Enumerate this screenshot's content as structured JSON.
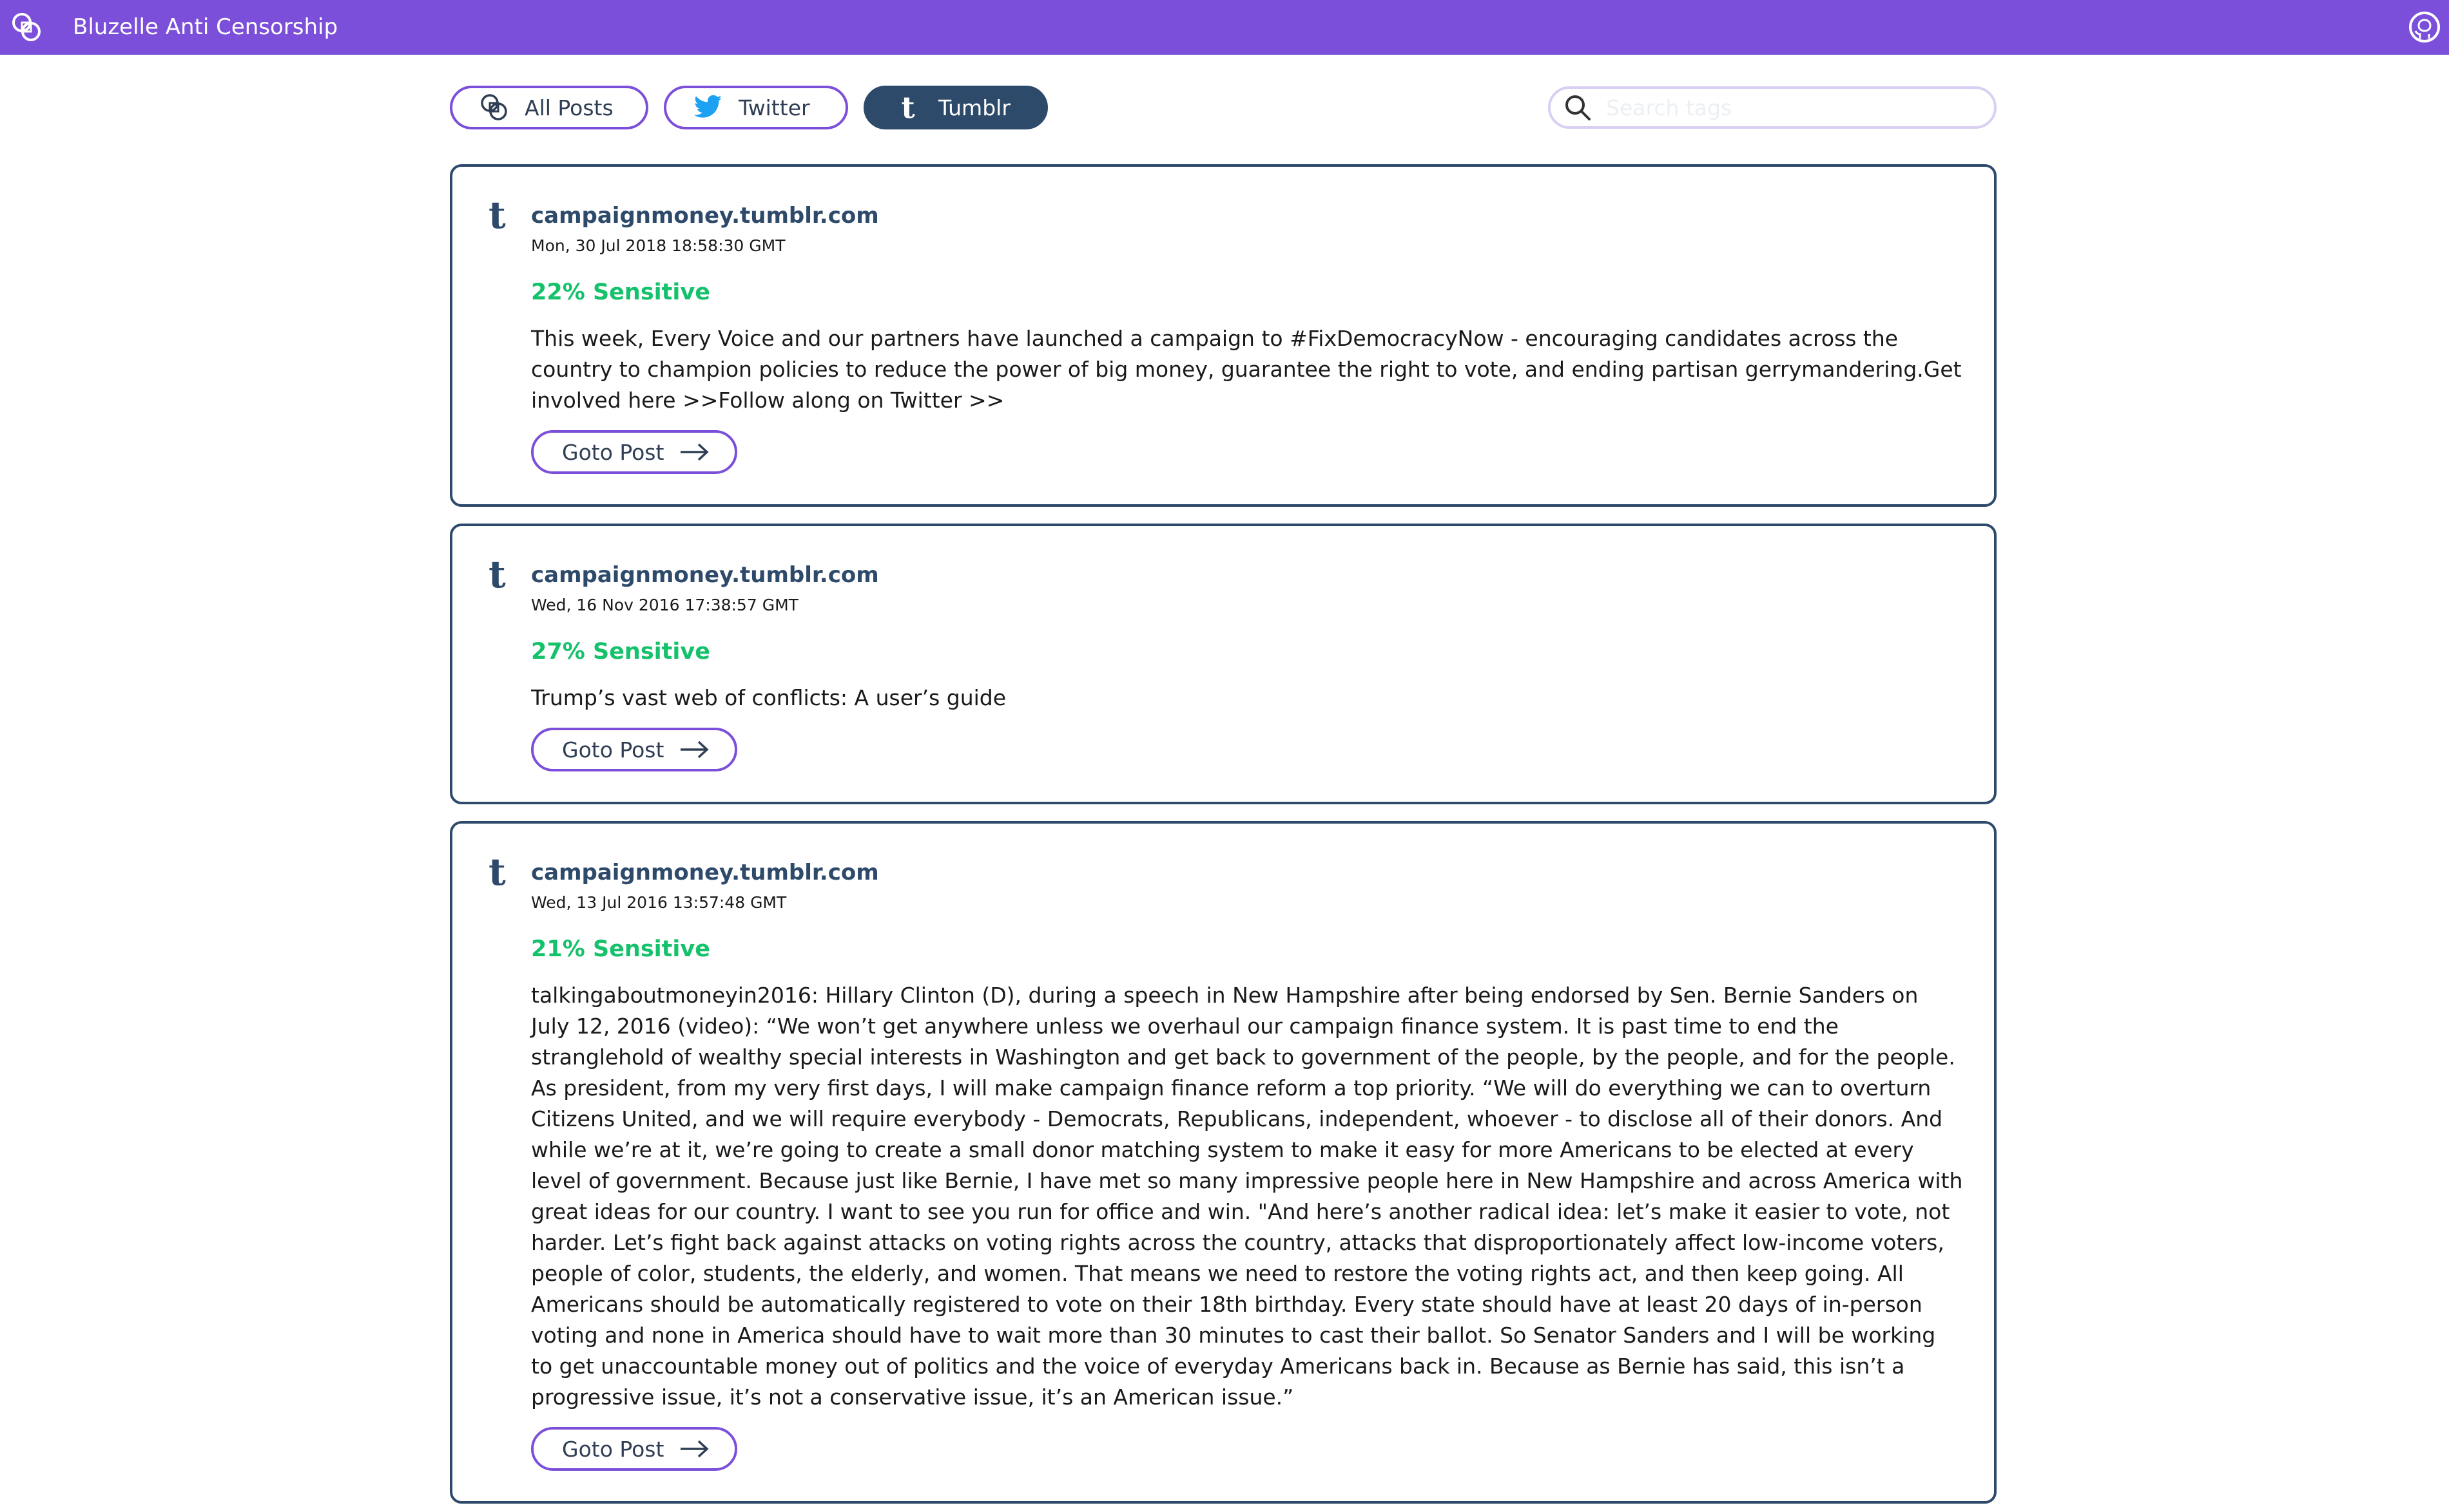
{
  "app": {
    "title": "Bluzelle Anti Censorship",
    "brand_color": "#7b4fd9"
  },
  "filters": [
    {
      "label": "All Posts",
      "icon": "bluzelle-logo-icon",
      "active": false
    },
    {
      "label": "Twitter",
      "icon": "twitter-icon",
      "active": false
    },
    {
      "label": "Tumblr",
      "icon": "tumblr-icon",
      "active": true
    }
  ],
  "search": {
    "placeholder": "Search tags",
    "value": ""
  },
  "posts": [
    {
      "author": "campaignmoney.tumblr.com",
      "date": "Mon, 30 Jul 2018 18:58:30 GMT",
      "sensitivity": "22% Sensitive",
      "body": "This week, Every Voice and our partners have launched a campaign to #FixDemocracyNow - encouraging candidates across the country to champion policies to reduce the power of big money, guarantee the right to vote, and ending partisan gerrymandering.Get involved here >>Follow along on Twitter >>",
      "button": "Goto Post"
    },
    {
      "author": "campaignmoney.tumblr.com",
      "date": "Wed, 16 Nov 2016 17:38:57 GMT",
      "sensitivity": "27% Sensitive",
      "body": "Trump’s vast web of conflicts: A user’s guide",
      "button": "Goto Post"
    },
    {
      "author": "campaignmoney.tumblr.com",
      "date": "Wed, 13 Jul 2016 13:57:48 GMT",
      "sensitivity": "21% Sensitive",
      "body": "talkingaboutmoneyin2016: Hillary Clinton (D), during a speech in New Hampshire after being endorsed by Sen. Bernie Sanders on July 12, 2016 (video): “We won’t get anywhere unless we overhaul our campaign finance system. It is past time to end the stranglehold of wealthy special interests in Washington and get back to government of the people, by the people, and for the people. As president, from my very first days, I will make campaign finance reform a top priority. “We will do everything we can to overturn Citizens United, and we will require everybody - Democrats, Republicans, independent, whoever - to disclose all of their donors. And while we’re at it, we’re going to create a small donor matching system to make it easy for more Americans to be elected at every level of government. Because just like Bernie, I have met so many impressive people here in New Hampshire and across America with great ideas for our country. I want to see you run for office and win. \"And here’s another radical idea: let’s make it easier to vote, not harder. Let’s fight back against attacks on voting rights across the country, attacks that disproportionately affect low-income voters, people of color, students, the elderly, and women. That means we need to restore the voting rights act, and then keep going. All Americans should be automatically registered to vote on their 18th birthday. Every state should have at least 20 days of in-person voting and none in America should have to wait more than 30 minutes to cast their ballot. So Senator Sanders and I will be working to get unaccountable money out of politics and the voice of everyday Americans back in. Because as Bernie has said, this isn’t a progressive issue, it’s not a conservative issue, it’s an American issue.”",
      "button": "Goto Post"
    }
  ]
}
